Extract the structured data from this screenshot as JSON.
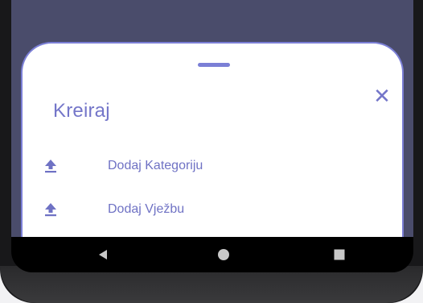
{
  "sheet": {
    "title": "Kreiraj",
    "close_icon": "close-icon",
    "items": [
      {
        "label": "Dodaj Kategoriju",
        "icon": "upload-icon"
      },
      {
        "label": "Dodaj Vježbu",
        "icon": "upload-icon"
      }
    ]
  },
  "navbar": {
    "back_icon": "back-triangle-icon",
    "home_icon": "home-circle-icon",
    "recents_icon": "recents-square-icon"
  },
  "colors": {
    "accent": "#7476c9",
    "sheet_border": "#7b7fd6",
    "scrim": "#4a4c6b",
    "navbar": "#000000"
  }
}
